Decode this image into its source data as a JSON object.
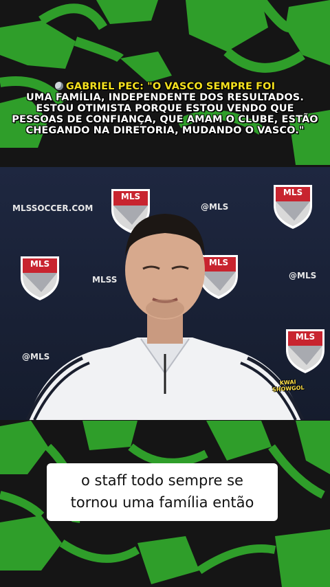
{
  "headline": {
    "icon": "microphone-icon",
    "speaker": "GABRIEL PEC:",
    "quote_line1": "\"O VASCO SEMPRE FOI",
    "quote_line2": "UMA FAMÍLIA, INDEPENDENTE DOS RESULTADOS.",
    "quote_line3": "ESTOU OTIMISTA PORQUE ESTOU VENDO QUE",
    "quote_line4": "PESSOAS DE CONFIANÇA, QUE AMAM O CLUBE, ESTÃO",
    "quote_line5": "CHEGANDO NA DIRETORIA, MUDANDO O VASCO.\""
  },
  "backdrop": {
    "logo_text": "MLS",
    "site_text": "MLSSOCCER.COM",
    "handle_text": "@MLS",
    "partial_text": "MLSS"
  },
  "watermark": {
    "line1": "KWAI",
    "line2": "SHOWGOL"
  },
  "subtitle": {
    "line1": "o staff todo sempre se",
    "line2": "tornou uma família então"
  },
  "colors": {
    "pattern_green": "#2f9e2a",
    "background_dark": "#141414",
    "speaker_yellow": "#f4e01e",
    "backdrop_navy": "#1b2336",
    "mls_red": "#c8242f"
  }
}
